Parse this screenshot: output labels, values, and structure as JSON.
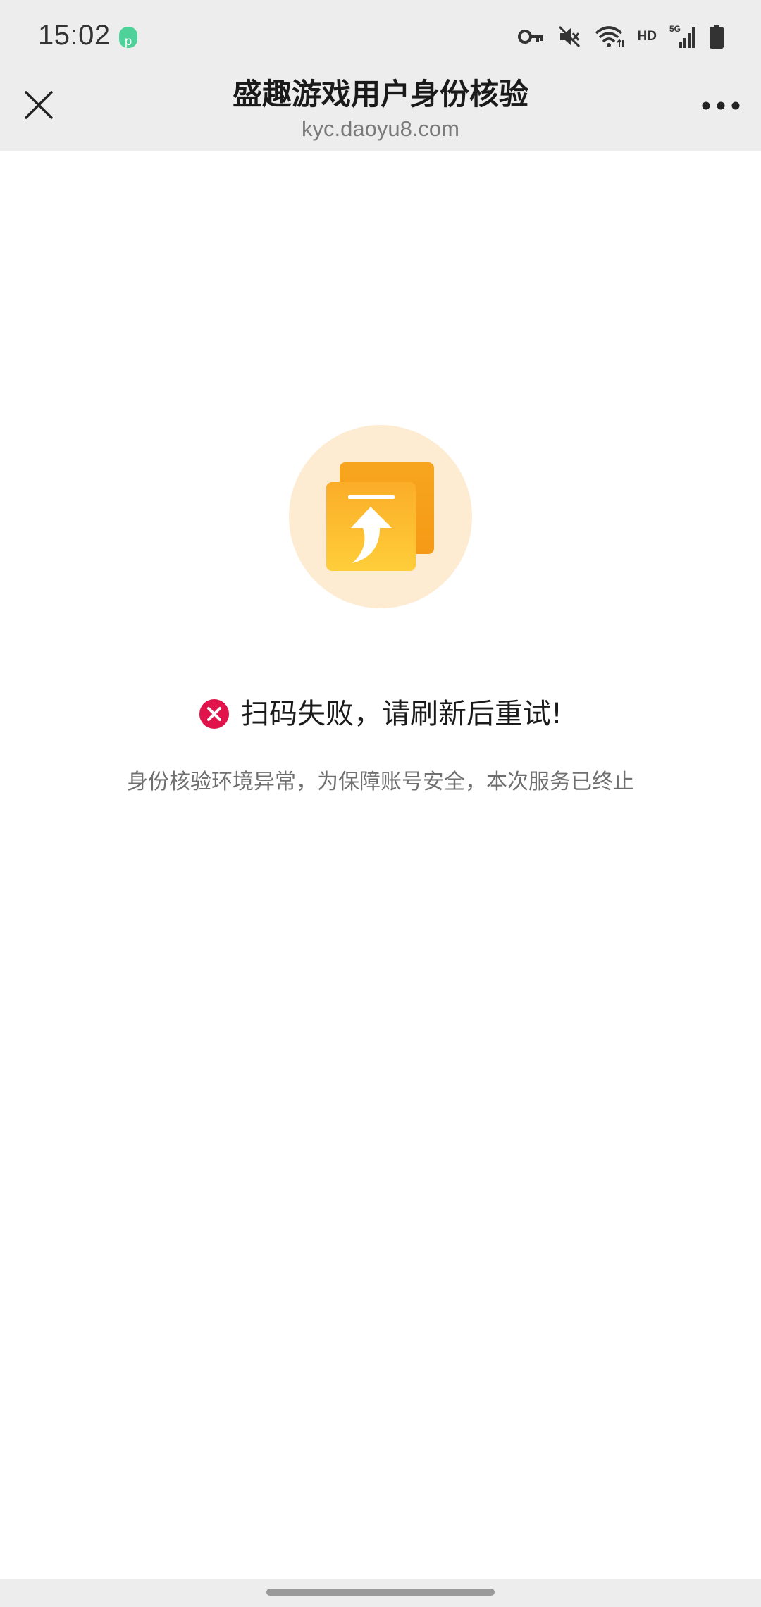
{
  "status_bar": {
    "time": "15:02",
    "hd": "HD",
    "network": "5G",
    "icons": [
      "app-notification-icon",
      "key-icon",
      "mute-icon",
      "wifi-icon",
      "signal-icon",
      "battery-icon"
    ]
  },
  "nav": {
    "title": "盛趣游戏用户身份核验",
    "subtitle": "kyc.daoyu8.com",
    "close_icon": "close-icon",
    "more_icon": "more-icon"
  },
  "content": {
    "illustration_icon": "upload-document-icon",
    "error_message": "扫码失败，请刷新后重试!",
    "detail_message": "身份核验环境异常，为保障账号安全，本次服务已终止"
  },
  "colors": {
    "bar_background": "#ededed",
    "page_background": "#ffffff",
    "error_red": "#e0134a",
    "illustration_circle": "#fdebd2",
    "folder_orange": "#f6a31d",
    "folder_yellow": "#fdbf2d"
  }
}
